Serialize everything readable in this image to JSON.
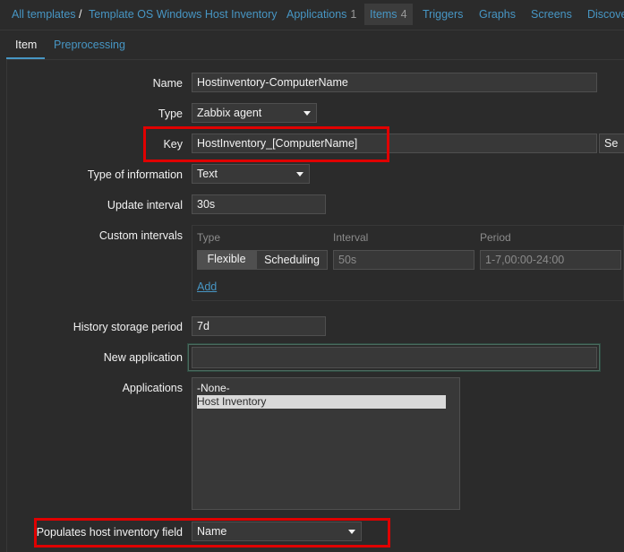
{
  "breadcrumb": {
    "all_templates": "All templates",
    "separator": "/",
    "template_name": "Template OS Windows Host Inventory"
  },
  "tabs": {
    "applications": {
      "label": "Applications",
      "count": "1"
    },
    "items": {
      "label": "Items",
      "count": "4"
    },
    "triggers": "Triggers",
    "graphs": "Graphs",
    "screens": "Screens",
    "discovery": "Discove"
  },
  "subtabs": {
    "item": "Item",
    "preprocessing": "Preprocessing"
  },
  "form": {
    "name": {
      "label": "Name",
      "value": "Hostinventory-ComputerName"
    },
    "type": {
      "label": "Type",
      "value": "Zabbix agent"
    },
    "key": {
      "label": "Key",
      "value": "HostInventory_[ComputerName]",
      "select_button": "Se"
    },
    "type_of_information": {
      "label": "Type of information",
      "value": "Text"
    },
    "update_interval": {
      "label": "Update interval",
      "value": "30s"
    },
    "custom_intervals": {
      "label": "Custom intervals",
      "col_type": "Type",
      "col_interval": "Interval",
      "col_period": "Period",
      "flexible": "Flexible",
      "scheduling": "Scheduling",
      "interval_value": "50s",
      "period_value": "1-7,00:00-24:00",
      "add": "Add"
    },
    "history_storage_period": {
      "label": "History storage period",
      "value": "7d"
    },
    "new_application": {
      "label": "New application",
      "value": ""
    },
    "applications": {
      "label": "Applications",
      "options": [
        "-None-",
        "Host Inventory"
      ],
      "selected": "Host Inventory"
    },
    "populates_host_inventory_field": {
      "label": "Populates host inventory field",
      "value": "Name"
    }
  },
  "colors": {
    "accent": "#4796c4",
    "highlight": "#e00000",
    "background": "#2b2b2b"
  }
}
